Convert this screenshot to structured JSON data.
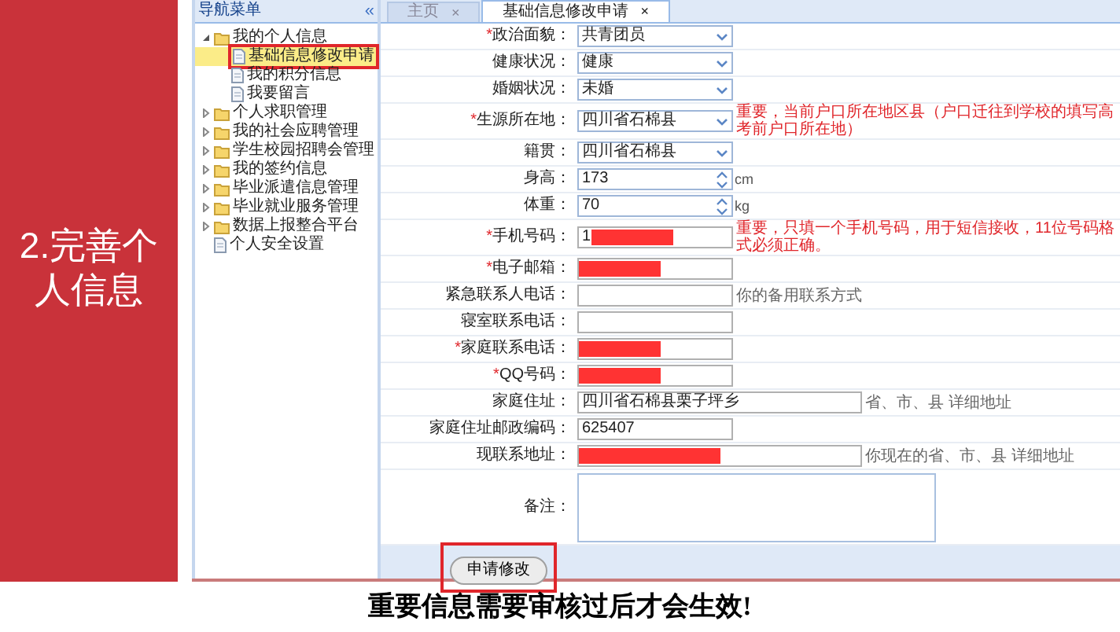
{
  "slide": {
    "heading": "2.完善个人信息",
    "caption": "重要信息需要审核过后才会生效!"
  },
  "sidebar": {
    "title": "导航菜单",
    "collapse": "«",
    "items": [
      {
        "label": "我的个人信息",
        "kind": "folder",
        "expanded": true,
        "children": [
          {
            "label": "基础信息修改申请",
            "kind": "page",
            "selected": true,
            "highlighted": true
          },
          {
            "label": "我的积分信息",
            "kind": "page",
            "selected": false,
            "highlighted": false
          },
          {
            "label": "我要留言",
            "kind": "page",
            "selected": false,
            "highlighted": false
          }
        ]
      },
      {
        "label": "个人求职管理",
        "kind": "folder",
        "expanded": false
      },
      {
        "label": "我的社会应聘管理",
        "kind": "folder",
        "expanded": false
      },
      {
        "label": "学生校园招聘会管理",
        "kind": "folder",
        "expanded": false
      },
      {
        "label": "我的签约信息",
        "kind": "folder",
        "expanded": false
      },
      {
        "label": "毕业派遣信息管理",
        "kind": "folder",
        "expanded": false
      },
      {
        "label": "毕业就业服务管理",
        "kind": "folder",
        "expanded": false
      },
      {
        "label": "数据上报整合平台",
        "kind": "folder",
        "expanded": false
      },
      {
        "label": "个人安全设置",
        "kind": "page",
        "selected": false,
        "highlighted": false
      }
    ]
  },
  "tabs": [
    {
      "label": "主页",
      "close": "×",
      "selected": false
    },
    {
      "label": "基础信息修改申请",
      "close": "×",
      "selected": true
    }
  ],
  "form": {
    "rows": [
      {
        "label": "政治面貌：",
        "mark": "*",
        "kind": "select",
        "value": "共青团员"
      },
      {
        "label": "健康状况：",
        "kind": "select",
        "value": "健康"
      },
      {
        "label": "婚姻状况：",
        "kind": "select",
        "value": "未婚"
      },
      {
        "label": "生源所在地：",
        "mark": "*",
        "kind": "select",
        "value": "四川省石棉县",
        "hint": "重要，当前户口所在地区县（户口迁往到学校的填写高考前户口所在地）",
        "hint_important": true
      },
      {
        "label": "籍贯：",
        "kind": "select",
        "value": "四川省石棉县"
      },
      {
        "label": "身高：",
        "kind": "spin",
        "value": "173",
        "unit": "cm"
      },
      {
        "label": "体重：",
        "kind": "spin",
        "value": "70",
        "unit": "kg"
      },
      {
        "label": "手机号码：",
        "mark": "*",
        "kind": "text",
        "value": "1",
        "redacted": true,
        "hint": "重要，只填一个手机号码，用于短信接收，11位号码格式必须正确。",
        "hint_important": true
      },
      {
        "label": "电子邮箱：",
        "mark": "*",
        "kind": "text",
        "redacted": true
      },
      {
        "label": "紧急联系人电话：",
        "kind": "text",
        "hint": "你的备用联系方式",
        "hint_important": false
      },
      {
        "label": "寝室联系电话：",
        "kind": "text"
      },
      {
        "label": "家庭联系电话：",
        "mark": "*",
        "kind": "text",
        "redacted": true
      },
      {
        "label": "QQ号码：",
        "mark": "*",
        "kind": "text",
        "redacted": true
      },
      {
        "label": "家庭住址：",
        "kind": "text",
        "wide": true,
        "value": "四川省石棉县栗子坪乡",
        "hint": "省、市、县 详细地址",
        "hint_important": false
      },
      {
        "label": "家庭住址邮政编码：",
        "kind": "text",
        "value": "625407"
      },
      {
        "label": "现联系地址：",
        "kind": "text",
        "wide": true,
        "redacted": true,
        "hint": "你现在的省、市、县 详细地址",
        "hint_important": false
      },
      {
        "label": "备注：",
        "kind": "textarea"
      }
    ],
    "submit": {
      "label": "申请修改",
      "highlighted": true
    }
  }
}
